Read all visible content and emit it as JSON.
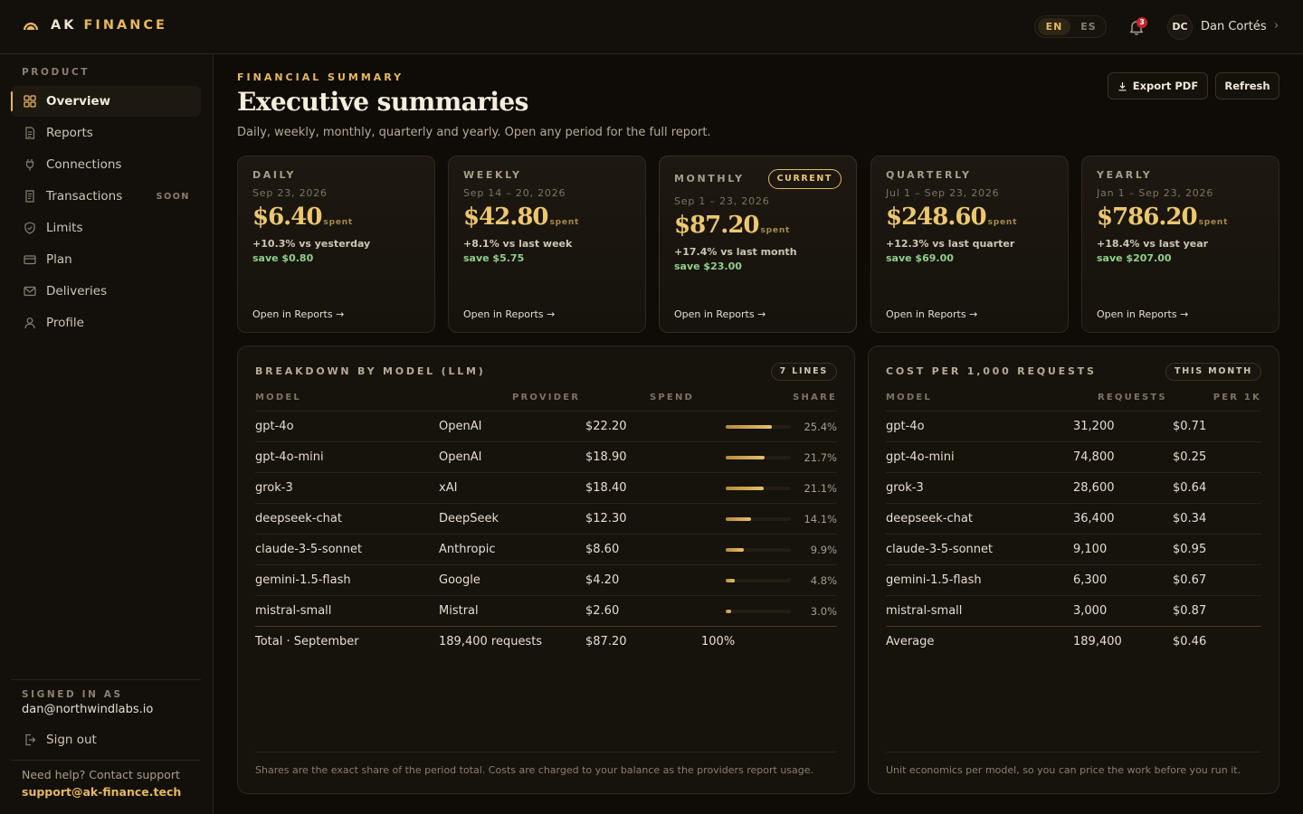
{
  "brand": {
    "name_a": "AK",
    "name_b": "FINANCE",
    "accent": "#e6b85c"
  },
  "topbar": {
    "languages": [
      "EN",
      "ES"
    ],
    "active_language": "EN",
    "notifications_count": "3",
    "user_initials": "DC",
    "user_name": "Dan Cortés"
  },
  "sidebar": {
    "section_label": "PRODUCT",
    "items": [
      {
        "label": "Overview",
        "icon": "grid-icon",
        "active": true
      },
      {
        "label": "Reports",
        "icon": "document-icon"
      },
      {
        "label": "Connections",
        "icon": "plug-icon"
      },
      {
        "label": "Transactions",
        "icon": "receipt-icon",
        "tag": "SOON"
      },
      {
        "label": "Limits",
        "icon": "shield-icon"
      },
      {
        "label": "Plan",
        "icon": "card-icon"
      },
      {
        "label": "Deliveries",
        "icon": "mail-icon"
      },
      {
        "label": "Profile",
        "icon": "user-icon"
      }
    ],
    "signed_in_label": "SIGNED IN AS",
    "signed_in_email": "dan@northwindlabs.io",
    "sign_out": "Sign out",
    "help_text": "Need help? Contact support",
    "help_email": "support@ak-finance.tech"
  },
  "header": {
    "eyebrow": "FINANCIAL SUMMARY",
    "title": "Executive summaries",
    "subtitle": "Daily, weekly, monthly, quarterly and yearly. Open any period for the full report.",
    "export_label": "Export PDF",
    "refresh_label": "Refresh"
  },
  "periods": [
    {
      "label": "DAILY",
      "date": "Sep 23, 2026",
      "amount": "$6.40",
      "spent": "spent",
      "change": "+10.3% vs yesterday",
      "save": "save $0.80",
      "link": "Open in Reports →"
    },
    {
      "label": "WEEKLY",
      "date": "Sep 14 – 20, 2026",
      "amount": "$42.80",
      "spent": "spent",
      "change": "+8.1% vs last week",
      "save": "save $5.75",
      "link": "Open in Reports →"
    },
    {
      "label": "MONTHLY",
      "date": "Sep 1 – 23, 2026",
      "amount": "$87.20",
      "spent": "spent",
      "change": "+17.4% vs last month",
      "save": "save $23.00",
      "link": "Open in Reports →",
      "badge": "CURRENT"
    },
    {
      "label": "QUARTERLY",
      "date": "Jul 1 – Sep 23, 2026",
      "amount": "$248.60",
      "spent": "spent",
      "change": "+12.3% vs last quarter",
      "save": "save $69.00",
      "link": "Open in Reports →"
    },
    {
      "label": "YEARLY",
      "date": "Jan 1 – Sep 23, 2026",
      "amount": "$786.20",
      "spent": "spent",
      "change": "+18.4% vs last year",
      "save": "save $207.00",
      "link": "Open in Reports →"
    }
  ],
  "breakdown": {
    "title": "BREAKDOWN BY MODEL (LLM)",
    "pill": "7 LINES",
    "columns": [
      "MODEL",
      "PROVIDER",
      "SPEND",
      "SHARE"
    ],
    "rows": [
      {
        "model": "gpt-4o",
        "provider": "OpenAI",
        "spend": "$22.20",
        "share": "25.4%",
        "share_value": 25.4
      },
      {
        "model": "gpt-4o-mini",
        "provider": "OpenAI",
        "spend": "$18.90",
        "share": "21.7%",
        "share_value": 21.7
      },
      {
        "model": "grok-3",
        "provider": "xAI",
        "spend": "$18.40",
        "share": "21.1%",
        "share_value": 21.1
      },
      {
        "model": "deepseek-chat",
        "provider": "DeepSeek",
        "spend": "$12.30",
        "share": "14.1%",
        "share_value": 14.1
      },
      {
        "model": "claude-3-5-sonnet",
        "provider": "Anthropic",
        "spend": "$8.60",
        "share": "9.9%",
        "share_value": 9.9
      },
      {
        "model": "gemini-1.5-flash",
        "provider": "Google",
        "spend": "$4.20",
        "share": "4.8%",
        "share_value": 4.8
      },
      {
        "model": "mistral-small",
        "provider": "Mistral",
        "spend": "$2.60",
        "share": "3.0%",
        "share_value": 3.0
      }
    ],
    "total": {
      "label": "Total · September",
      "requests": "189,400 requests",
      "spend": "$87.20",
      "share": "100%"
    },
    "footnote": "Shares are the exact share of the period total. Costs are charged to your balance as the providers report usage."
  },
  "cost_per_1k": {
    "title": "COST PER 1,000 REQUESTS",
    "pill": "THIS MONTH",
    "columns": [
      "MODEL",
      "REQUESTS",
      "PER 1K"
    ],
    "rows": [
      {
        "model": "gpt-4o",
        "requests": "31,200",
        "per1k": "$0.71"
      },
      {
        "model": "gpt-4o-mini",
        "requests": "74,800",
        "per1k": "$0.25"
      },
      {
        "model": "grok-3",
        "requests": "28,600",
        "per1k": "$0.64"
      },
      {
        "model": "deepseek-chat",
        "requests": "36,400",
        "per1k": "$0.34"
      },
      {
        "model": "claude-3-5-sonnet",
        "requests": "9,100",
        "per1k": "$0.95"
      },
      {
        "model": "gemini-1.5-flash",
        "requests": "6,300",
        "per1k": "$0.67"
      },
      {
        "model": "mistral-small",
        "requests": "3,000",
        "per1k": "$0.87"
      }
    ],
    "average": {
      "label": "Average",
      "requests": "189,400",
      "per1k": "$0.46"
    },
    "footnote": "Unit economics per model, so you can price the work before you run it."
  }
}
